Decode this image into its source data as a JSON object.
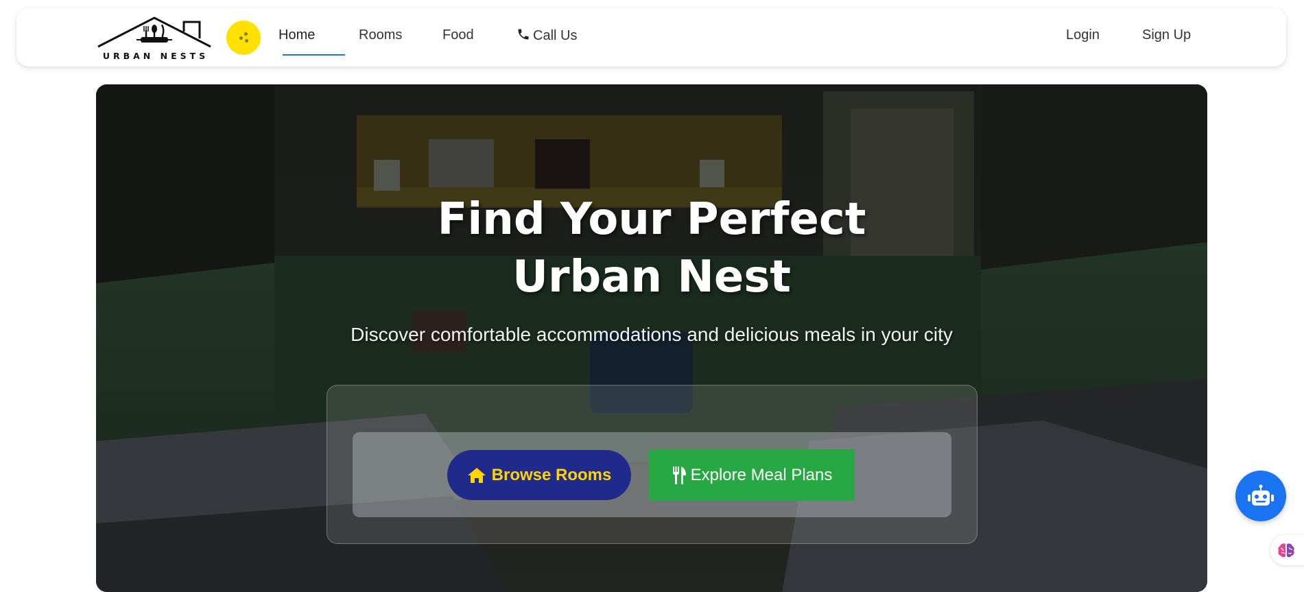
{
  "brand": {
    "logo_text": "URBAN NESTS"
  },
  "nav": {
    "links": [
      {
        "label": "Home",
        "active": true
      },
      {
        "label": "Rooms"
      },
      {
        "label": "Food"
      },
      {
        "label": "Call Us",
        "icon": "phone-icon"
      }
    ],
    "auth": {
      "login": "Login",
      "signup": "Sign Up"
    }
  },
  "hero": {
    "title": "Find Your Perfect Urban Nest",
    "subtitle": "Discover comfortable accommodations and delicious meals in your city",
    "primary_cta": {
      "label": "Browse Rooms",
      "icon": "home-icon"
    },
    "secondary_cta": {
      "label": "Explore Meal Plans",
      "icon": "utensils-icon"
    }
  },
  "floating": {
    "chatbot_icon": "robot-icon",
    "assistant_icon": "brain-icon"
  },
  "colors": {
    "accent_blue": "#1a73e8",
    "toggle_yellow": "#ffe000",
    "primary_button_bg": "#1f2a8a",
    "primary_button_text": "#ffd500",
    "secondary_button_bg": "#28a745",
    "chatbot_bg": "#1a73f0"
  }
}
